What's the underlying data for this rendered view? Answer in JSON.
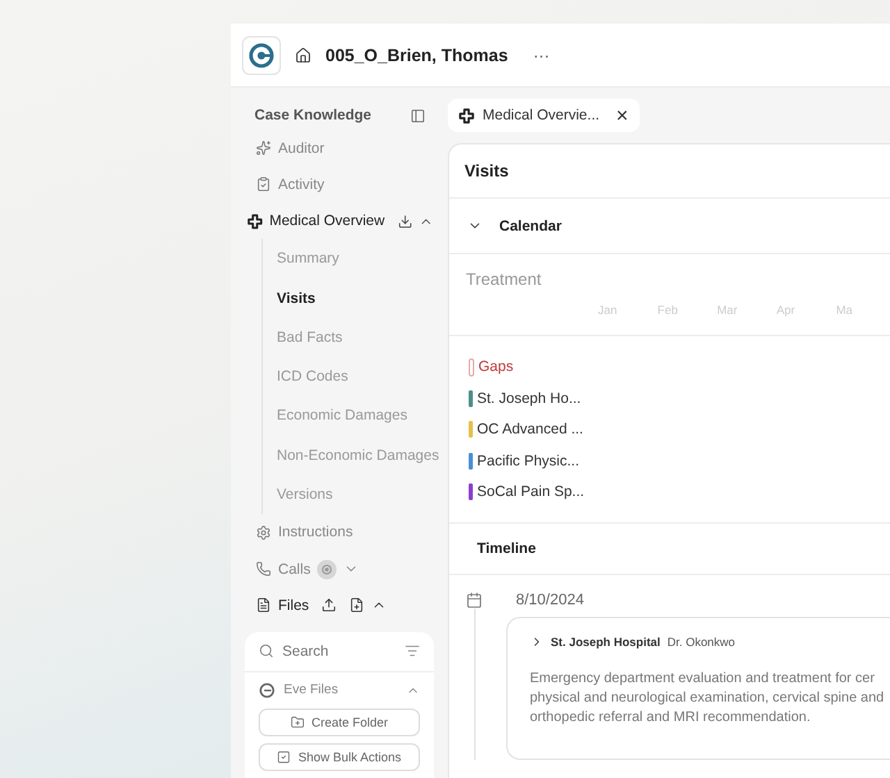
{
  "header": {
    "title": "005_O_Brien, Thomas",
    "more": "···"
  },
  "sidebar": {
    "title": "Case Knowledge",
    "items": [
      {
        "kind": "auditor",
        "label": "Auditor"
      },
      {
        "kind": "activity",
        "label": "Activity"
      }
    ],
    "medical": {
      "label": "Medical Overview",
      "expanded": true,
      "children": [
        {
          "label": "Summary",
          "selected": false
        },
        {
          "label": "Visits",
          "selected": true
        },
        {
          "label": "Bad Facts",
          "selected": false
        },
        {
          "label": "ICD Codes",
          "selected": false
        },
        {
          "label": "Economic Damages",
          "selected": false
        },
        {
          "label": "Non-Economic Damages",
          "selected": false
        },
        {
          "label": "Versions",
          "selected": false
        }
      ]
    },
    "after": [
      {
        "kind": "instructions",
        "label": "Instructions",
        "expanded": false
      },
      {
        "kind": "calls",
        "label": "Calls",
        "expanded": false
      }
    ],
    "files": {
      "label": "Files",
      "expanded": true,
      "search": {
        "placeholder": "Search"
      },
      "folder": {
        "label": "Eve Files",
        "expanded": true
      },
      "buttons": [
        {
          "kind": "folder",
          "label": "Create Folder"
        },
        {
          "kind": "bulk",
          "label": "Show Bulk Actions"
        }
      ]
    }
  },
  "tab": {
    "label": "Medical Overvie...",
    "close": "×"
  },
  "panel": {
    "title": "Visits",
    "calendar": {
      "label": "Calendar",
      "expanded": true,
      "heading": "Treatment",
      "months": [
        "Jan",
        "Feb",
        "Mar",
        "Apr",
        "Ma"
      ],
      "legend": [
        {
          "kind": "gap",
          "label": "Gaps",
          "color": "#e7a9a9"
        },
        {
          "kind": "provider",
          "label": "St. Joseph Ho...",
          "color": "#4b8f8c"
        },
        {
          "kind": "provider",
          "label": "OC Advanced ...",
          "color": "#e5c04b"
        },
        {
          "kind": "provider",
          "label": "Pacific Physic...",
          "color": "#4a8fd6"
        },
        {
          "kind": "provider",
          "label": "SoCal Pain Sp...",
          "color": "#8a3fd1"
        }
      ]
    },
    "timeline": {
      "label": "Timeline",
      "entries": [
        {
          "date": "8/10/2024",
          "facility": "St. Joseph Hospital",
          "doctor": "Dr. Okonkwo",
          "expanded": false,
          "text": "Emergency department evaluation and treatment for cer\nphysical and neurological examination, cervical spine and\northopedic referral and MRI recommendation."
        }
      ]
    }
  }
}
